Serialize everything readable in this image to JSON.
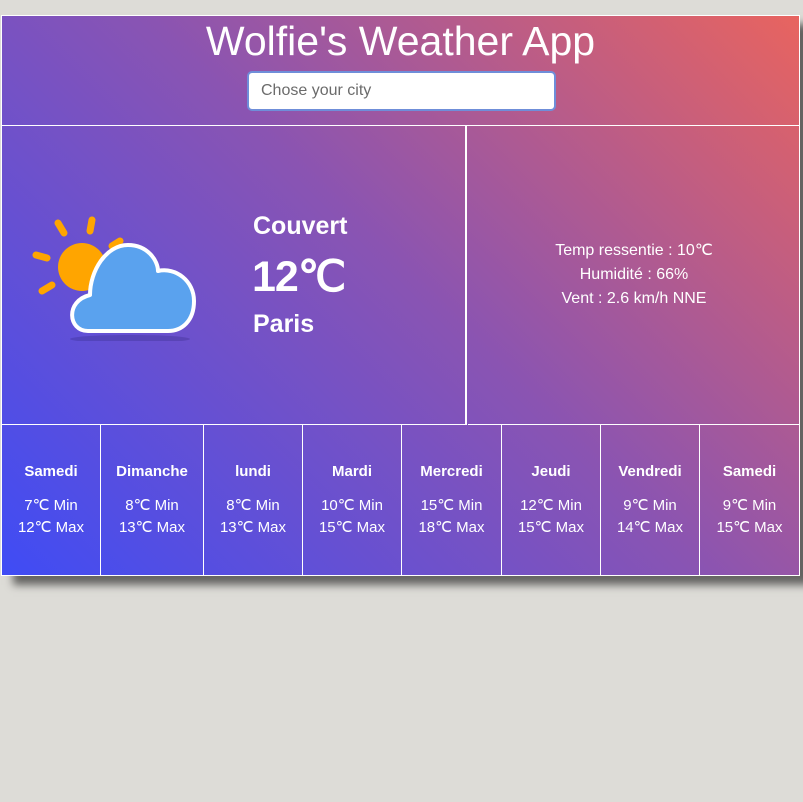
{
  "header": {
    "title": "Wolfie's Weather App",
    "search_placeholder": "Chose your city"
  },
  "current": {
    "icon": "partly-cloudy-icon",
    "condition": "Couvert",
    "temperature": "12℃",
    "city": "Paris"
  },
  "details": {
    "feels_like": "Temp ressentie : 10℃",
    "humidity": "Humidité : 66%",
    "wind": "Vent : 2.6 km/h NNE"
  },
  "forecast": [
    {
      "day": "Samedi",
      "min": "7℃ Min",
      "max": "12℃ Max"
    },
    {
      "day": "Dimanche",
      "min": "8℃ Min",
      "max": "13℃ Max"
    },
    {
      "day": "lundi",
      "min": "8℃ Min",
      "max": "13℃ Max"
    },
    {
      "day": "Mardi",
      "min": "10℃ Min",
      "max": "15℃ Max"
    },
    {
      "day": "Mercredi",
      "min": "15℃ Min",
      "max": "18℃ Max"
    },
    {
      "day": "Jeudi",
      "min": "12℃ Min",
      "max": "15℃ Max"
    },
    {
      "day": "Vendredi",
      "min": "9℃ Min",
      "max": "14℃ Max"
    },
    {
      "day": "Samedi",
      "min": "9℃ Min",
      "max": "15℃ Max"
    }
  ],
  "colors": {
    "gradient_start": "#3f4cf5",
    "gradient_mid": "#8a54b2",
    "gradient_end": "#e8645f",
    "sun": "#ffa500",
    "cloud": "#5aa2ee",
    "background": "#dddcd7"
  }
}
